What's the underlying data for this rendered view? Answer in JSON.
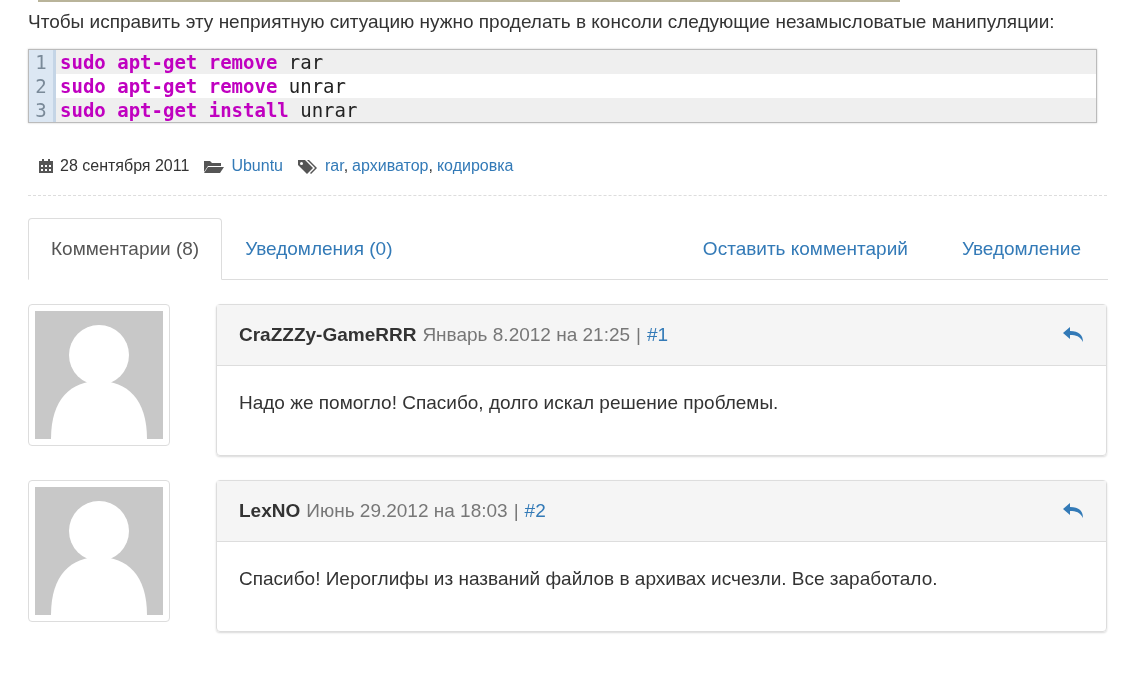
{
  "intro": "Чтобы исправить эту неприятную ситуацию нужно проделать в консоли следующие незамысловатые манипуляции:",
  "code": {
    "lines": [
      {
        "number": "1",
        "tokens": [
          {
            "kind": "keyword",
            "text": "sudo apt-get remove"
          },
          {
            "kind": "plain",
            "text": " rar"
          }
        ]
      },
      {
        "number": "2",
        "tokens": [
          {
            "kind": "keyword",
            "text": "sudo apt-get remove"
          },
          {
            "kind": "plain",
            "text": " unrar"
          }
        ]
      },
      {
        "number": "3",
        "tokens": [
          {
            "kind": "keyword",
            "text": "sudo apt-get install"
          },
          {
            "kind": "plain",
            "text": " unrar"
          }
        ]
      }
    ]
  },
  "meta": {
    "date": "28 сентября 2011",
    "category": "Ubuntu",
    "tags": [
      "rar",
      "архиватор",
      "кодировка"
    ],
    "separator": ","
  },
  "tabs": [
    {
      "label": "Комментарии (8)",
      "selected": true
    },
    {
      "label": "Уведомления (0)",
      "selected": false
    }
  ],
  "actions": [
    "Оставить комментарий",
    "Уведомление"
  ],
  "comments": [
    {
      "author": "CraZZZy-GameRRR",
      "date": "Январь 8.2012 на 21:25",
      "divider": "|",
      "anchor": "#1",
      "text": "Надо же помогло! Спасибо, долго искал решение проблемы."
    },
    {
      "author": "LexNO",
      "date": "Июнь 29.2012 на 18:03",
      "divider": "|",
      "anchor": "#2",
      "text": "Спасибо! Иероглифы из названий файлов в архивах исчезли. Все заработало."
    }
  ]
}
